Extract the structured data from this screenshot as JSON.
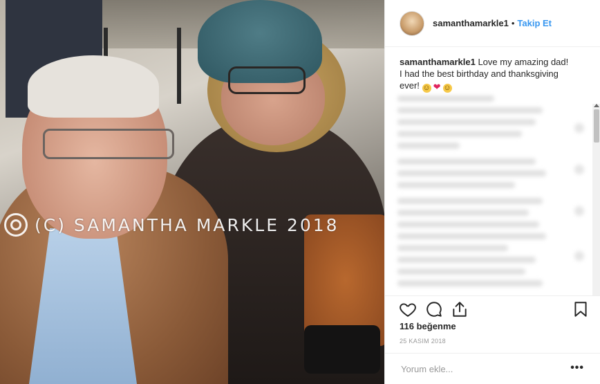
{
  "post": {
    "username": "samanthamarkle1",
    "follow_label": "Takip Et",
    "separator": "•",
    "caption": {
      "username": "samanthamarkle1",
      "text": " Love my amazing dad! I had the best birthday and thanksgiving ever! ",
      "emojis": [
        "grinning-face-with-sweat-icon",
        "red-heart-icon",
        "winking-face-icon"
      ]
    },
    "watermark": "(C) SAMANTHA MARKLE 2018",
    "likes": "116 beğenme",
    "date": "25 KASIM 2018",
    "comment_placeholder": "Yorum ekle...",
    "more_label": "•••"
  },
  "icons": {
    "like": "heart-outline-icon",
    "comment": "comment-bubble-icon",
    "share": "share-icon",
    "save": "bookmark-icon"
  },
  "colors": {
    "accent": "#3897f0",
    "text": "#262626",
    "muted": "#999999",
    "border": "#efefef"
  }
}
